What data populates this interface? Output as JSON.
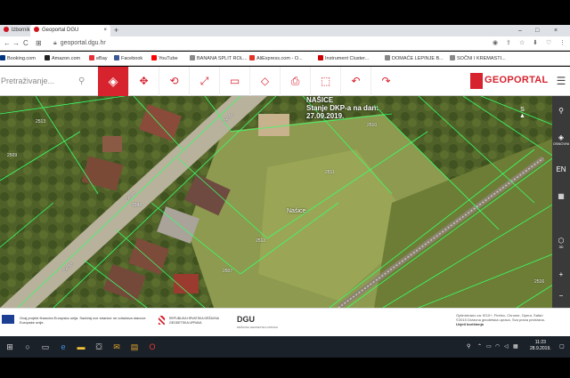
{
  "browser": {
    "tabs": [
      {
        "label": "lzbornik",
        "active": false
      },
      {
        "label": "Geoportal DGU",
        "active": true
      }
    ],
    "new_tab": "+",
    "window_controls": [
      "–",
      "□",
      "×"
    ],
    "url": "geoportal.dgu.hr",
    "nav": {
      "back": "←",
      "forward": "→",
      "reload": "C",
      "apps": "⊞"
    }
  },
  "bookmarks": [
    {
      "label": "Booking.com",
      "color": "#003580"
    },
    {
      "label": "Amazon.com",
      "color": "#222222"
    },
    {
      "label": "eBay",
      "color": "#e53238"
    },
    {
      "label": "Facebook",
      "color": "#3b5998"
    },
    {
      "label": "YouTube",
      "color": "#ff0000"
    },
    {
      "label": "BANANA SPLIT ROL...",
      "color": "#888888"
    },
    {
      "label": "AliExpress.com - O...",
      "color": "#e43225"
    },
    {
      "label": "Instrument Cluster...",
      "color": "#cc0000"
    },
    {
      "label": "DOMAĆE LEPINJE B...",
      "color": "#888888"
    },
    {
      "label": "SOČNI I KREMASTI...",
      "color": "#888888"
    }
  ],
  "geobar": {
    "search_placeholder": "Pretraživanje...",
    "search_icon": "search-icon",
    "layers_icon": "layers-icon",
    "tools": [
      {
        "name": "pan-icon",
        "glyph": "✥"
      },
      {
        "name": "zoom-area-icon",
        "glyph": "⟲"
      },
      {
        "name": "fullscreen-icon",
        "glyph": "⤢"
      },
      {
        "name": "measure-area-icon",
        "glyph": "▭"
      },
      {
        "name": "measure-line-icon",
        "glyph": "◇"
      },
      {
        "name": "print-icon",
        "glyph": "⎙"
      },
      {
        "name": "select-icon",
        "glyph": "⬚"
      },
      {
        "name": "undo-icon",
        "glyph": "↶"
      },
      {
        "name": "redo-icon",
        "glyph": "↷"
      }
    ],
    "logo_text": "GEOPORTAL",
    "menu_icon": "☰"
  },
  "map": {
    "overlay_line1": "NAŠICE",
    "overlay_line2": "Stanje DKP-a na dan:",
    "overlay_line3": "27.09.2019.",
    "place_label": "Našice",
    "parcel_labels": [
      "2511",
      "2510",
      "2509",
      "2512",
      "2507",
      "1548",
      "2513",
      "2516"
    ],
    "street_label": "Cesta"
  },
  "side_tools": [
    {
      "glyph": "⚲",
      "label": ""
    },
    {
      "glyph": "◈",
      "label": "OSNOVNI"
    },
    {
      "glyph": "EN",
      "label": ""
    },
    {
      "glyph": "▦",
      "label": ""
    },
    {
      "glyph": "⬡",
      "label": "3D"
    },
    {
      "glyph": "+",
      "label": ""
    },
    {
      "glyph": "−",
      "label": ""
    }
  ],
  "footer": {
    "eu_text": "Ovaj projekt financira Europska unija. Sadržaj ove stranice ne odražava stavove Europske unije.",
    "cro_text": "REPUBLIKA HRVATSKA DRŽAVNA GEODETSKA UPRAVA",
    "dgu": "DGU",
    "dgu_sub": "DRŽAVNA GEODETSKA UPRAVA",
    "copyright_line1": "Optimizirano za: IE10+, Firefox, Chrome, Opera, Safari",
    "copyright_line2": "©2015 Državna geodetska uprava. Sva prava pridržana.",
    "copyright_line3": "Uvjeti korištenja"
  },
  "taskbar": {
    "time": "11:23",
    "date": "28.9.2019."
  }
}
